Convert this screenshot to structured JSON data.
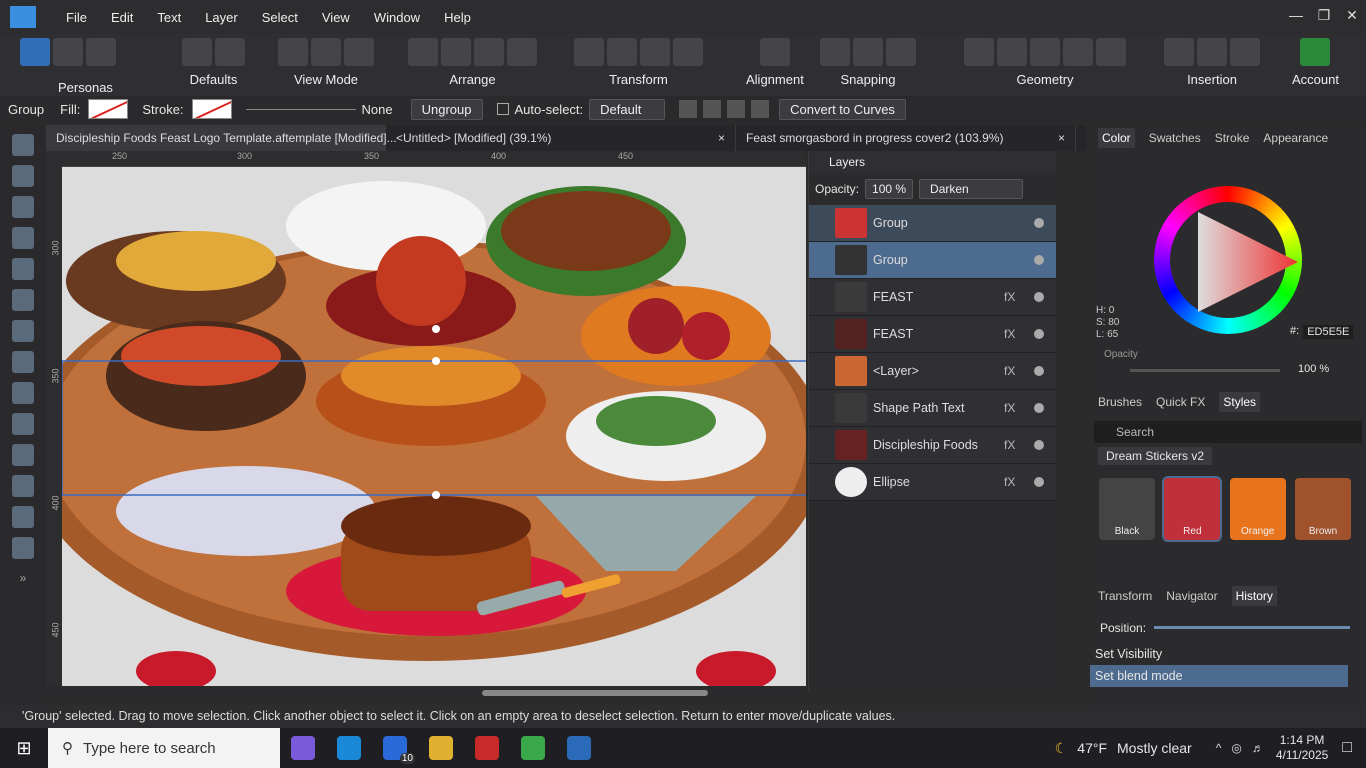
{
  "menu": {
    "items": [
      "File",
      "Edit",
      "Text",
      "Layer",
      "Select",
      "View",
      "Window",
      "Help"
    ]
  },
  "toolbar": {
    "personas": "Personas",
    "defaults": "Defaults",
    "view_mode": "View Mode",
    "arrange": "Arrange",
    "transform": "Transform",
    "alignment": "Alignment",
    "snapping": "Snapping",
    "geometry": "Geometry",
    "insertion": "Insertion",
    "account": "Account"
  },
  "context": {
    "group": "Group",
    "fill": "Fill:",
    "stroke": "Stroke:",
    "none": "None",
    "ungroup": "Ungroup",
    "autoselect": "Auto-select:",
    "autoselect_value": "Default",
    "convert": "Convert to Curves"
  },
  "tabs": [
    {
      "label": "Discipleship Foods Feast Logo Template.aftemplate [Modified]...",
      "close": "×"
    },
    {
      "label": "<Untitled> [Modified] (39.1%)",
      "close": "×"
    },
    {
      "label": "Feast smorgasbord in progress cover2 (103.9%)",
      "close": "×"
    }
  ],
  "ruler": {
    "h": [
      "250",
      "300",
      "350",
      "400",
      "450"
    ],
    "v": [
      "300",
      "350",
      "400",
      "450"
    ]
  },
  "layers": {
    "title": "Layers",
    "opacity_label": "Opacity:",
    "opacity_value": "100 %",
    "blend": "Darken",
    "rows": [
      {
        "name": "Group",
        "fx": ""
      },
      {
        "name": "Group",
        "fx": ""
      },
      {
        "name": "FEAST",
        "fx": "fX"
      },
      {
        "name": "FEAST",
        "fx": "fX"
      },
      {
        "name": "<Layer>",
        "fx": "fX"
      },
      {
        "name": "Shape Path Text",
        "fx": "fX"
      },
      {
        "name": "Discipleship Foods",
        "fx": "fX"
      },
      {
        "name": "Ellipse",
        "fx": "fX"
      }
    ]
  },
  "color": {
    "tabs": [
      "Color",
      "Swatches",
      "Stroke",
      "Appearance"
    ],
    "h": "H: 0",
    "s": "S: 80",
    "l": "L: 65",
    "hex_label": "#:",
    "hex": "ED5E5E",
    "opacity_label": "Opacity",
    "opacity_value": "100 %"
  },
  "styles": {
    "tabs": [
      "Brushes",
      "Quick FX",
      "Styles"
    ],
    "search_placeholder": "Search",
    "category": "Dream Stickers v2",
    "items": [
      {
        "name": "Black",
        "color": "#444444"
      },
      {
        "name": "Red",
        "color": "#c0303a"
      },
      {
        "name": "Orange",
        "color": "#e8741e"
      },
      {
        "name": "Brown",
        "color": "#a0522d"
      }
    ]
  },
  "history": {
    "tabs": [
      "Transform",
      "Navigator",
      "History"
    ],
    "position_label": "Position:",
    "items": [
      "Set Visibility",
      "Set blend mode"
    ]
  },
  "status": {
    "text": "'Group' selected. Drag to move selection. Click another object to select it. Click on an empty area to deselect selection. Return to enter move/duplicate values."
  },
  "taskbar": {
    "search": "Type here to search",
    "weather_temp": "47°F",
    "weather_desc": "Mostly clear",
    "time": "1:14 PM",
    "date": "4/11/2025",
    "mail_badge": "10"
  }
}
